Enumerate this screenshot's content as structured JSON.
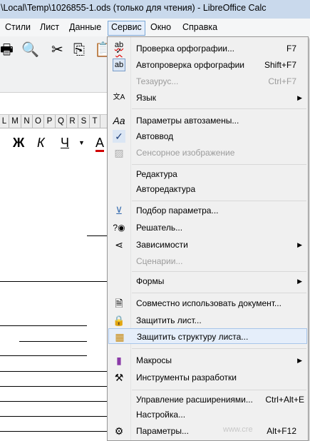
{
  "window": {
    "title": "\\Local\\Temp\\1026855-1.ods (только для чтения) - LibreOffice Calc"
  },
  "menubar": [
    "Стили",
    "Лист",
    "Данные",
    "Сервис",
    "Окно",
    "Справка"
  ],
  "format": {
    "bold": "Ж",
    "italic": "К",
    "underline": "Ч",
    "font_color": "А"
  },
  "columns": [
    "L",
    "M",
    "N",
    "O",
    "P",
    "Q",
    "R",
    "S",
    "T"
  ],
  "menu": {
    "items": [
      {
        "icon": "spellcheck-icon",
        "label": "Проверка орфографии...",
        "shortcut": "F7"
      },
      {
        "icon": "autospellcheck-icon",
        "label": "Автопроверка орфографии",
        "shortcut": "Shift+F7"
      },
      {
        "icon": "",
        "label": "Тезаурус...",
        "shortcut": "Ctrl+F7"
      },
      {
        "icon": "language-icon",
        "label": "Язык",
        "shortcut": ""
      },
      {
        "icon": "autocorrect-icon",
        "label": "Параметры автозамены...",
        "shortcut": ""
      },
      {
        "icon": "checkmark-icon",
        "label": "Автоввод",
        "shortcut": ""
      },
      {
        "icon": "image-icon",
        "label": "Сенсорное изображение",
        "shortcut": ""
      },
      {
        "icon": "",
        "label": "Редактура",
        "shortcut": ""
      },
      {
        "icon": "",
        "label": "Авторедактура",
        "shortcut": ""
      },
      {
        "icon": "goal-seek-icon",
        "label": "Подбор параметра...",
        "shortcut": ""
      },
      {
        "icon": "solver-icon",
        "label": "Решатель...",
        "shortcut": ""
      },
      {
        "icon": "dependencies-icon",
        "label": "Зависимости",
        "shortcut": ""
      },
      {
        "icon": "",
        "label": "Сценарии...",
        "shortcut": ""
      },
      {
        "icon": "",
        "label": "Формы",
        "shortcut": ""
      },
      {
        "icon": "share-document-icon",
        "label": "Совместно использовать документ...",
        "shortcut": ""
      },
      {
        "icon": "protect-sheet-icon",
        "label": "Защитить лист...",
        "shortcut": ""
      },
      {
        "icon": "protect-structure-icon",
        "label": "Защитить структуру листа...",
        "shortcut": ""
      },
      {
        "icon": "macros-icon",
        "label": "Макросы",
        "shortcut": ""
      },
      {
        "icon": "developer-tools-icon",
        "label": "Инструменты разработки",
        "shortcut": ""
      },
      {
        "icon": "",
        "label": "Управление расширениями...",
        "shortcut": "Ctrl+Alt+E"
      },
      {
        "icon": "",
        "label": "Настройка...",
        "shortcut": ""
      },
      {
        "icon": "gear-icon",
        "label": "Параметры...",
        "shortcut": "Alt+F12"
      }
    ]
  },
  "watermark": "www.cre"
}
